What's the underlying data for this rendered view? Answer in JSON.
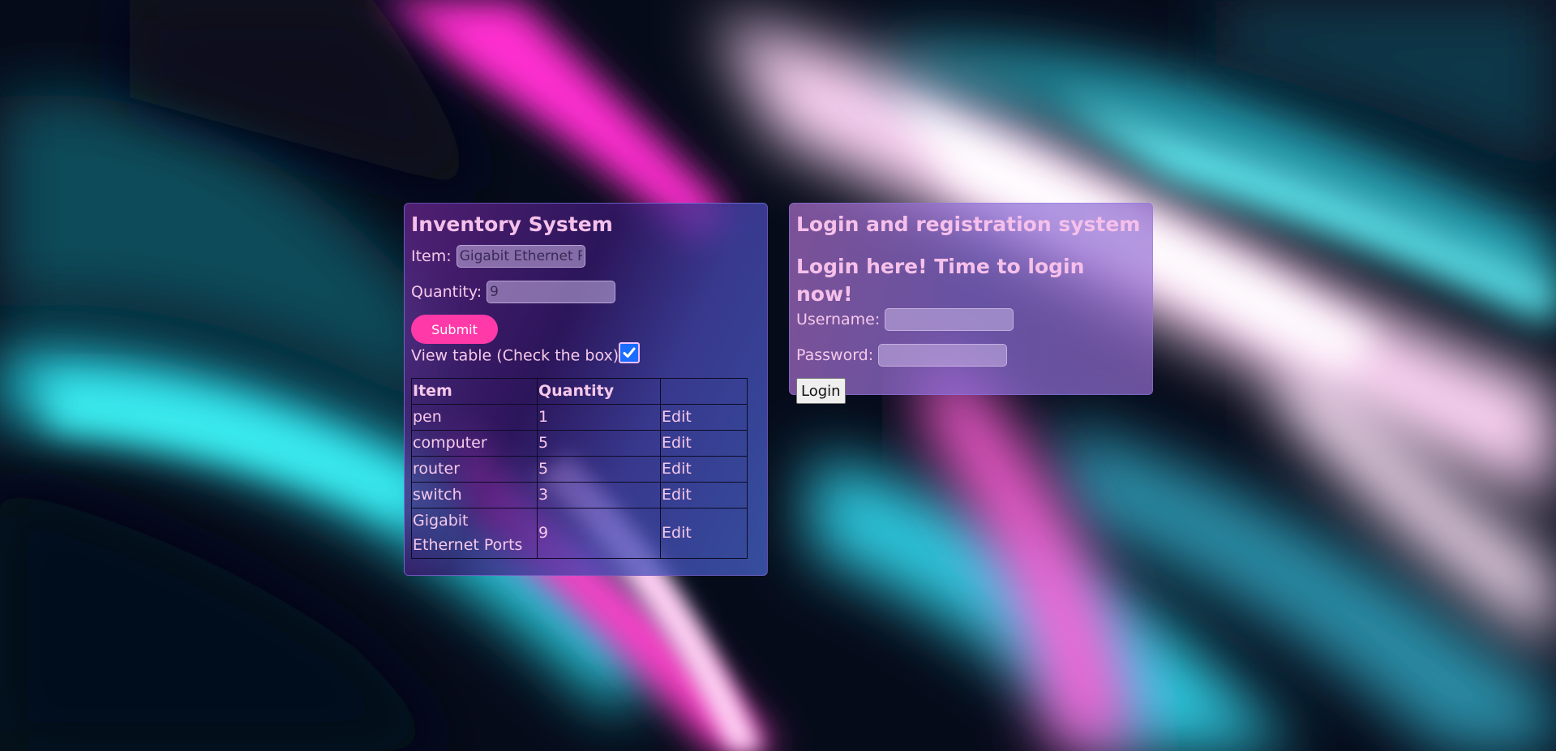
{
  "inventory": {
    "title": "Inventory System",
    "item_label": "Item:",
    "item_value": "Gigabit Ethernet Ports",
    "quantity_label": "Quantity:",
    "quantity_value": "9",
    "submit_label": "Submit",
    "view_table_label": "View table (Check the box)",
    "view_table_checked": true,
    "table": {
      "headers": [
        "Item",
        "Quantity",
        ""
      ],
      "rows": [
        {
          "item": "pen",
          "quantity": "1",
          "action": "Edit"
        },
        {
          "item": "computer",
          "quantity": "5",
          "action": "Edit"
        },
        {
          "item": "router",
          "quantity": "5",
          "action": "Edit"
        },
        {
          "item": "switch",
          "quantity": "3",
          "action": "Edit"
        },
        {
          "item": "Gigabit Ethernet Ports",
          "quantity": "9",
          "action": "Edit"
        }
      ]
    }
  },
  "login": {
    "title": "Login and registration system",
    "subtitle": "Login here! Time to login now!",
    "username_label": "Username:",
    "username_value": "",
    "password_label": "Password:",
    "password_value": "",
    "login_label": "Login"
  },
  "colors": {
    "accent_pink": "#ff3aa8",
    "text_pink": "#f6c8ea",
    "checkbox_blue": "#1a6dff"
  }
}
